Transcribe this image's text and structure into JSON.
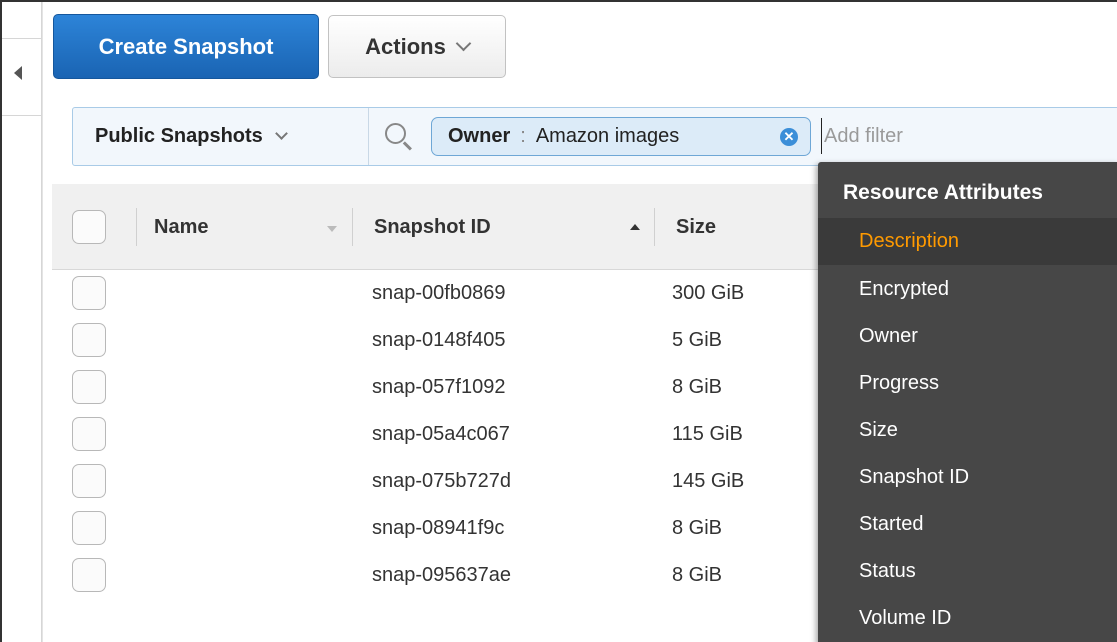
{
  "toolbar": {
    "create_label": "Create Snapshot",
    "actions_label": "Actions"
  },
  "filter": {
    "scope_label": "Public Snapshots",
    "token": {
      "key": "Owner",
      "separator": ":",
      "value": "Amazon images",
      "remove_glyph": "✕"
    },
    "add_filter_placeholder": "Add filter"
  },
  "table": {
    "columns": {
      "name": "Name",
      "snapshot_id": "Snapshot ID",
      "size": "Size"
    },
    "rows": [
      {
        "snapshot_id": "snap-00fb0869",
        "size": "300 GiB"
      },
      {
        "snapshot_id": "snap-0148f405",
        "size": "5 GiB"
      },
      {
        "snapshot_id": "snap-057f1092",
        "size": "8 GiB"
      },
      {
        "snapshot_id": "snap-05a4c067",
        "size": "115 GiB"
      },
      {
        "snapshot_id": "snap-075b727d",
        "size": "145 GiB"
      },
      {
        "snapshot_id": "snap-08941f9c",
        "size": "8 GiB"
      },
      {
        "snapshot_id": "snap-095637ae",
        "size": "8 GiB"
      }
    ]
  },
  "attributes_menu": {
    "title": "Resource Attributes",
    "items": [
      "Description",
      "Encrypted",
      "Owner",
      "Progress",
      "Size",
      "Snapshot ID",
      "Started",
      "Status",
      "Volume ID"
    ],
    "active_item": "Description"
  },
  "colors": {
    "primary_button": "#1f6fc5",
    "menu_background": "#474747",
    "menu_active_text": "#ff9a00",
    "token_background": "#dcebf8"
  },
  "icons": {
    "collapse": "chevron-left-icon",
    "search": "search-icon",
    "remove_token": "close-circle-icon",
    "dropdown": "chevron-down-icon",
    "sort": "sort-ascending-icon"
  }
}
